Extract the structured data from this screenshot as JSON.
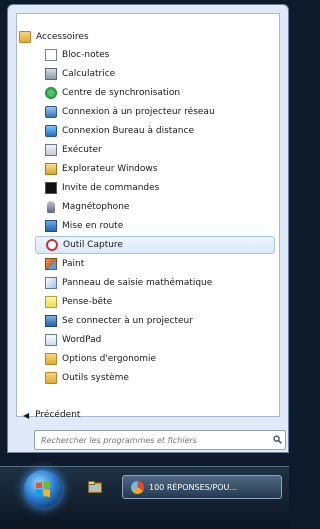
{
  "menu": {
    "folder": {
      "label": "Accessoires",
      "icon": "folder-icon"
    },
    "items": [
      {
        "label": "Bloc-notes",
        "icon": "notepad-icon"
      },
      {
        "label": "Calculatrice",
        "icon": "calculator-icon"
      },
      {
        "label": "Centre de synchronisation",
        "icon": "sync-center-icon"
      },
      {
        "label": "Connexion à un projecteur réseau",
        "icon": "network-projector-icon"
      },
      {
        "label": "Connexion Bureau à distance",
        "icon": "remote-desktop-icon"
      },
      {
        "label": "Exécuter",
        "icon": "run-icon"
      },
      {
        "label": "Explorateur Windows",
        "icon": "explorer-icon"
      },
      {
        "label": "Invite de commandes",
        "icon": "command-prompt-icon"
      },
      {
        "label": "Magnétophone",
        "icon": "microphone-icon"
      },
      {
        "label": "Mise en route",
        "icon": "getting-started-icon"
      },
      {
        "label": "Outil Capture",
        "icon": "snipping-tool-icon",
        "selected": true
      },
      {
        "label": "Paint",
        "icon": "paint-icon"
      },
      {
        "label": "Panneau de saisie mathématique",
        "icon": "math-input-icon"
      },
      {
        "label": "Pense-bête",
        "icon": "sticky-notes-icon"
      },
      {
        "label": "Se connecter à un projecteur",
        "icon": "projector-icon"
      },
      {
        "label": "WordPad",
        "icon": "wordpad-icon"
      },
      {
        "label": "Options d'ergonomie",
        "icon": "folder-icon"
      },
      {
        "label": "Outils système",
        "icon": "folder-icon"
      }
    ],
    "back_label": "Précédent"
  },
  "search": {
    "placeholder": "Rechercher les programmes et fichiers"
  },
  "taskbar": {
    "task_label": "100 RÉPONSES/POU...",
    "pinned_icon": "explorer-icon"
  },
  "colors": {
    "menu_bg": "#dfe9f7",
    "selection": "#dbe9fa",
    "taskbar": "#0b1521"
  }
}
